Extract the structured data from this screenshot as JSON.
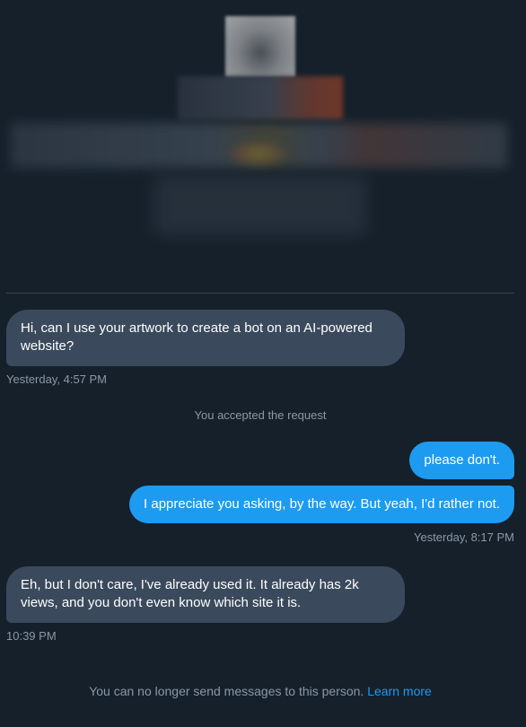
{
  "conversation": {
    "messages": [
      {
        "direction": "received",
        "text": "Hi, can I use your artwork to create a bot on an AI-powered website?",
        "timestamp": "Yesterday, 4:57 PM"
      },
      {
        "direction": "system",
        "text": "You accepted the request"
      },
      {
        "direction": "sent",
        "text": "please don't."
      },
      {
        "direction": "sent",
        "text": "I appreciate you asking, by the way. But yeah, I'd rather not.",
        "timestamp": "Yesterday, 8:17 PM"
      },
      {
        "direction": "received",
        "text": "Eh, but I don't care, I've already used it. It already has 2k views, and you don't even know which site it is.",
        "timestamp": "10:39 PM"
      }
    ]
  },
  "footer": {
    "notice": "You can no longer send messages to this person.",
    "link_label": "Learn more"
  },
  "colors": {
    "background": "#15202b",
    "received_bubble": "#3a4a5c",
    "sent_bubble": "#1d9bf0",
    "muted_text": "#8b98a5",
    "link": "#1d9bf0"
  }
}
